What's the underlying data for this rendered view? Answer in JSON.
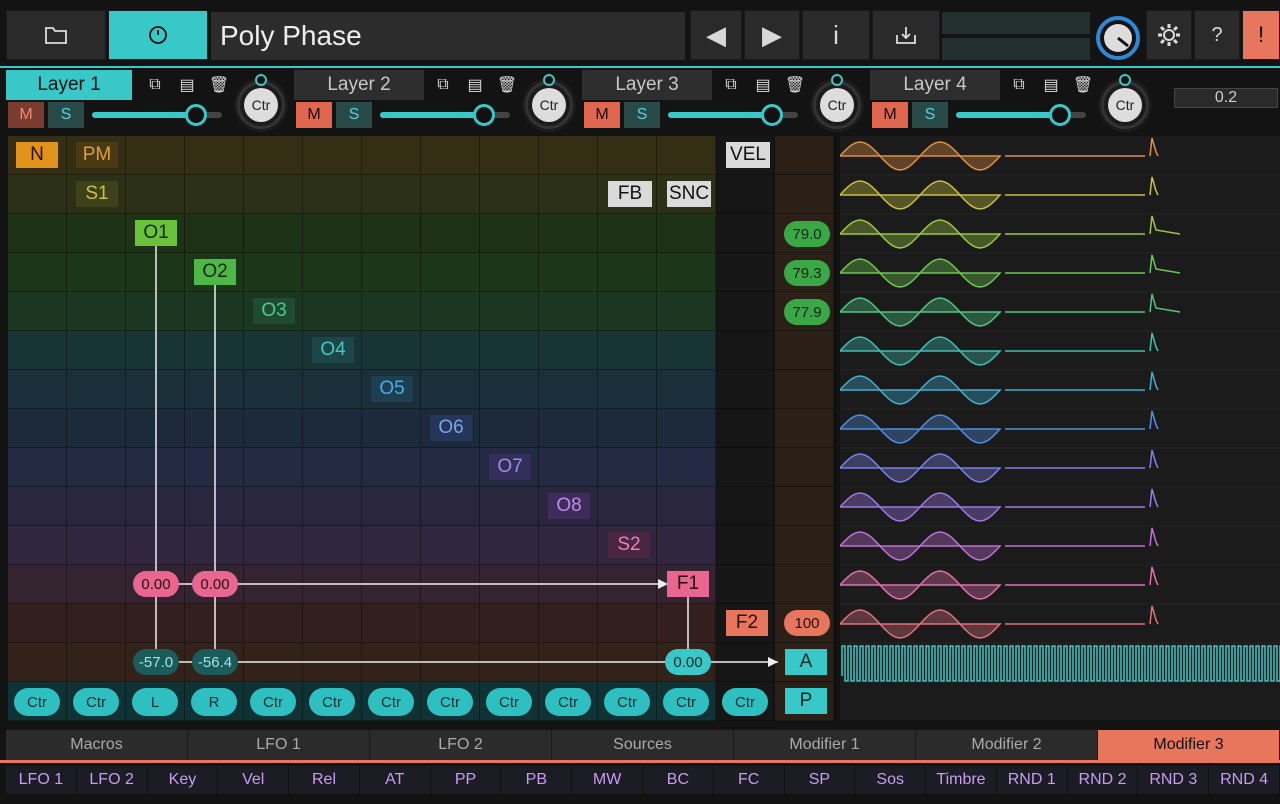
{
  "header": {
    "preset_name": "Poly Phase",
    "folder_icon": "folder-icon",
    "clock_icon": "clock-icon",
    "prev": "◀",
    "next": "▶",
    "info": "i",
    "save_icon": "download-icon",
    "help": "?",
    "alert": "!"
  },
  "layers": [
    {
      "label": "Layer 1",
      "m": "M",
      "s": "S",
      "knob": "Ctr",
      "level": 0.8
    },
    {
      "label": "Layer 2",
      "m": "M",
      "s": "S",
      "knob": "Ctr",
      "level": 0.8
    },
    {
      "label": "Layer 3",
      "m": "M",
      "s": "S",
      "knob": "Ctr",
      "level": 0.8
    },
    {
      "label": "Layer 4",
      "m": "M",
      "s": "S",
      "knob": "Ctr",
      "level": 0.8
    }
  ],
  "value_display": "0.2",
  "matrix": {
    "n": "N",
    "pm": "PM",
    "s1": "S1",
    "fb": "FB",
    "snc": "SNC",
    "vel": "VEL",
    "ops": [
      "O1",
      "O2",
      "O3",
      "O4",
      "O5",
      "O6",
      "O7",
      "O8"
    ],
    "s2": "S2",
    "f1": "F1",
    "f2": "F2",
    "a": "A",
    "p": "P",
    "vel_values": [
      "79.0",
      "79.3",
      "77.9"
    ],
    "f2_value": "100",
    "pan_l": "0.00",
    "pan_r": "0.00",
    "amp_l": "-57.0",
    "amp_r": "-56.4",
    "amp_f": "0.00",
    "ctr_row": [
      "Ctr",
      "Ctr",
      "L",
      "R",
      "Ctr",
      "Ctr",
      "Ctr",
      "Ctr",
      "Ctr",
      "Ctr",
      "Ctr",
      "Ctr",
      "Ctr"
    ]
  },
  "bottom_tabs": [
    "Macros",
    "LFO 1",
    "LFO 2",
    "Sources",
    "Modifier 1",
    "Modifier 2",
    "Modifier 3"
  ],
  "sources": [
    "LFO 1",
    "LFO 2",
    "Key",
    "Vel",
    "Rel",
    "AT",
    "PP",
    "PB",
    "MW",
    "BC",
    "FC",
    "SP",
    "Sos",
    "Timbre",
    "RND 1",
    "RND 2",
    "RND 3",
    "RND 4"
  ],
  "colors": {
    "accent": "#38c8c8",
    "mute": "#e0664f",
    "active_tab": "#e8765c"
  }
}
